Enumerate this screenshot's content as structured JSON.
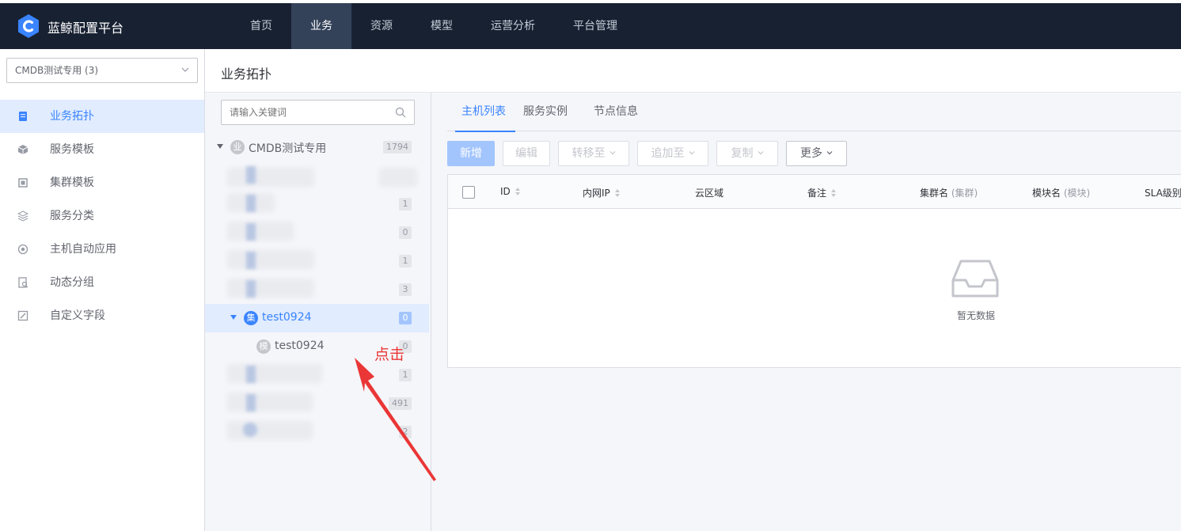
{
  "topbar": {
    "brand": "蓝鲸配置平台",
    "nav": [
      "首页",
      "业务",
      "资源",
      "模型",
      "运营分析",
      "平台管理"
    ],
    "active_nav": "业务"
  },
  "sidebar": {
    "biz_select": "CMDB测试专用 (3)",
    "items": [
      {
        "label": "业务拓扑",
        "icon": "topology-icon",
        "active": true
      },
      {
        "label": "服务模板",
        "icon": "cube-icon"
      },
      {
        "label": "集群模板",
        "icon": "cluster-icon"
      },
      {
        "label": "服务分类",
        "icon": "layers-icon"
      },
      {
        "label": "主机自动应用",
        "icon": "auto-apply-icon"
      },
      {
        "label": "动态分组",
        "icon": "dynamic-group-icon"
      },
      {
        "label": "自定义字段",
        "icon": "edit-field-icon"
      }
    ]
  },
  "header": {
    "title": "业务拓扑"
  },
  "tree": {
    "search_placeholder": "请输入关键词",
    "root": {
      "badge": "业",
      "name": "CMDB测试专用",
      "count": "1794"
    },
    "counts": [
      "1",
      "0",
      "1",
      "3",
      "1",
      "491",
      "2"
    ],
    "cluster": {
      "badge": "集",
      "name": "test0924",
      "count": "0"
    },
    "module": {
      "badge": "模",
      "name": "test0924",
      "count": "0"
    }
  },
  "annotation": {
    "text": "点击",
    "color": "#ea3636"
  },
  "tabs": [
    "主机列表",
    "服务实例",
    "节点信息"
  ],
  "toolbar": {
    "add": "新增",
    "edit": "编辑",
    "transfer": "转移至",
    "append": "追加至",
    "copy": "复制",
    "more": "更多"
  },
  "table": {
    "headers": {
      "id": "ID",
      "ip": "内网IP",
      "cloud": "云区域",
      "remark": "备注",
      "set": "集群名",
      "set_sub": "(集群)",
      "module": "模块名",
      "module_sub": "(模块)",
      "sla": "SLA级别"
    },
    "empty_text": "暂无数据"
  },
  "colors": {
    "primary": "#3a84ff",
    "nav_bg": "#182132",
    "active_nav_bg": "#334259"
  }
}
